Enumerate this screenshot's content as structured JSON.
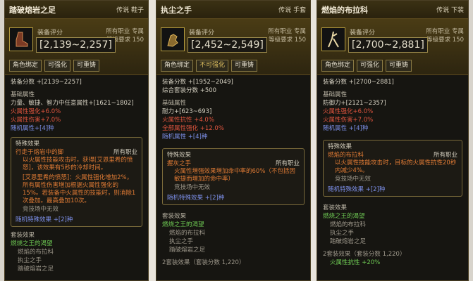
{
  "panels": [
    {
      "name": "踏破熔岩之足",
      "tag": "传说 鞋子",
      "score_title": "装备评分",
      "class_req": "所有职业 专属",
      "level_req": "等级要求 150",
      "score_range": "[2,139~2,257]",
      "buttons": [
        "角色绑定",
        "可强化",
        "可重铸"
      ],
      "equip_score": "装备分数 +[2139~2257]",
      "basic_title": "基础属性",
      "basic_lines": [
        {
          "text": "力量、敏捷、智力中任意属性+[1621~1802]",
          "color": "white"
        },
        {
          "text": "火属性强化+6.0%",
          "color": "red"
        },
        {
          "text": "火属性伤害+7.0%",
          "color": "red"
        },
        {
          "text": "随机属性+[4]种",
          "color": "blue"
        }
      ],
      "special_title": "特殊效果",
      "effect_name": "行走于熔岩中的脚",
      "effect_req": "所有职业",
      "effect_desc_1": "以火属性技能攻击时，获得[艾恩里希的愤怒]，该效果有5秒的冷却时间。",
      "effect_desc_2": "[艾恩里希的愤怒]：火属性强化增加2%，所有属性伤害增加根据火属性强化的15%。若装备中火属性的技能时，则消除1次叠加。最高叠加10次。",
      "no_conflict": "竞技场中无效",
      "random_special": "随机特殊效果 +[2]种",
      "set_title": "套装效果",
      "set_name": "燃烧之王的渴望",
      "set_items": [
        "燃焰的布拉科",
        "执尘之手",
        "踏破熔岩之足"
      ]
    },
    {
      "name": "执尘之手",
      "tag": "传说 手套",
      "score_title": "装备评分",
      "class_req": "所有职业 专属",
      "level_req": "等级要求 150",
      "score_range": "[2,452~2,549]",
      "buttons": [
        "角色绑定",
        "不可强化",
        "可重铸"
      ],
      "equip_score": "装备分数 +[1952~2049]",
      "extra_score": "综合套装分数 +500",
      "basic_title": "基础属性",
      "basic_lines": [
        {
          "text": "耐力+[623~693]",
          "color": "white"
        },
        {
          "text": "火属性抗性 +4.0%",
          "color": "red"
        },
        {
          "text": "全部属性强化 +12.0%",
          "color": "red"
        },
        {
          "text": "随机属性 +[4]种",
          "color": "blue"
        }
      ],
      "special_title": "特殊效果",
      "effect_name": "握灰之手",
      "effect_req": "所有职业",
      "effect_desc_1": "火属性增强效果增加命中率的60%（不包括因敏捷而增加的命中率）",
      "no_conflict": "竞技场中无效",
      "random_special": "随机特殊效果 +[2]种",
      "set_title": "套装效果",
      "set_name": "燃烧之王的渴望",
      "set_items": [
        "燃焰的布拉科",
        "执尘之手",
        "踏破熔岩之足"
      ],
      "set_bonus": "2套装效果（套装分数 1,220）"
    },
    {
      "name": "燃焰的布拉科",
      "tag": "传说 下装",
      "score_title": "装备评分",
      "class_req": "所有职业 专属",
      "level_req": "等级要求 150",
      "score_range": "[2,700~2,881]",
      "buttons": [
        "角色绑定",
        "可强化",
        "可重铸"
      ],
      "equip_score": "装备分数 +[2700~2881]",
      "basic_title": "基础属性",
      "basic_lines": [
        {
          "text": "防御力+[2121~2357]",
          "color": "white"
        },
        {
          "text": "火属性强化+6.0%",
          "color": "red"
        },
        {
          "text": "火属性伤害+7.0%",
          "color": "red"
        },
        {
          "text": "随机属性 +[4]种",
          "color": "blue"
        }
      ],
      "special_title": "特殊效果",
      "effect_name": "燃焰的布拉科",
      "effect_req": "所有职业",
      "effect_desc_1": "以火属性技能攻击时，目标的火属性抗性20秒内减少4%。",
      "no_conflict": "竞技场中无效",
      "random_special": "随机特殊效果 +[2]种",
      "set_title": "套装效果",
      "set_name": "燃烧之王的渴望",
      "set_items": [
        "燃焰的布拉科",
        "执尘之手",
        "踏破熔岩之足"
      ],
      "set_bonus": "2套装效果（套装分数 1,220）",
      "set_bonus_line": "火属性抗性 +20%"
    }
  ]
}
